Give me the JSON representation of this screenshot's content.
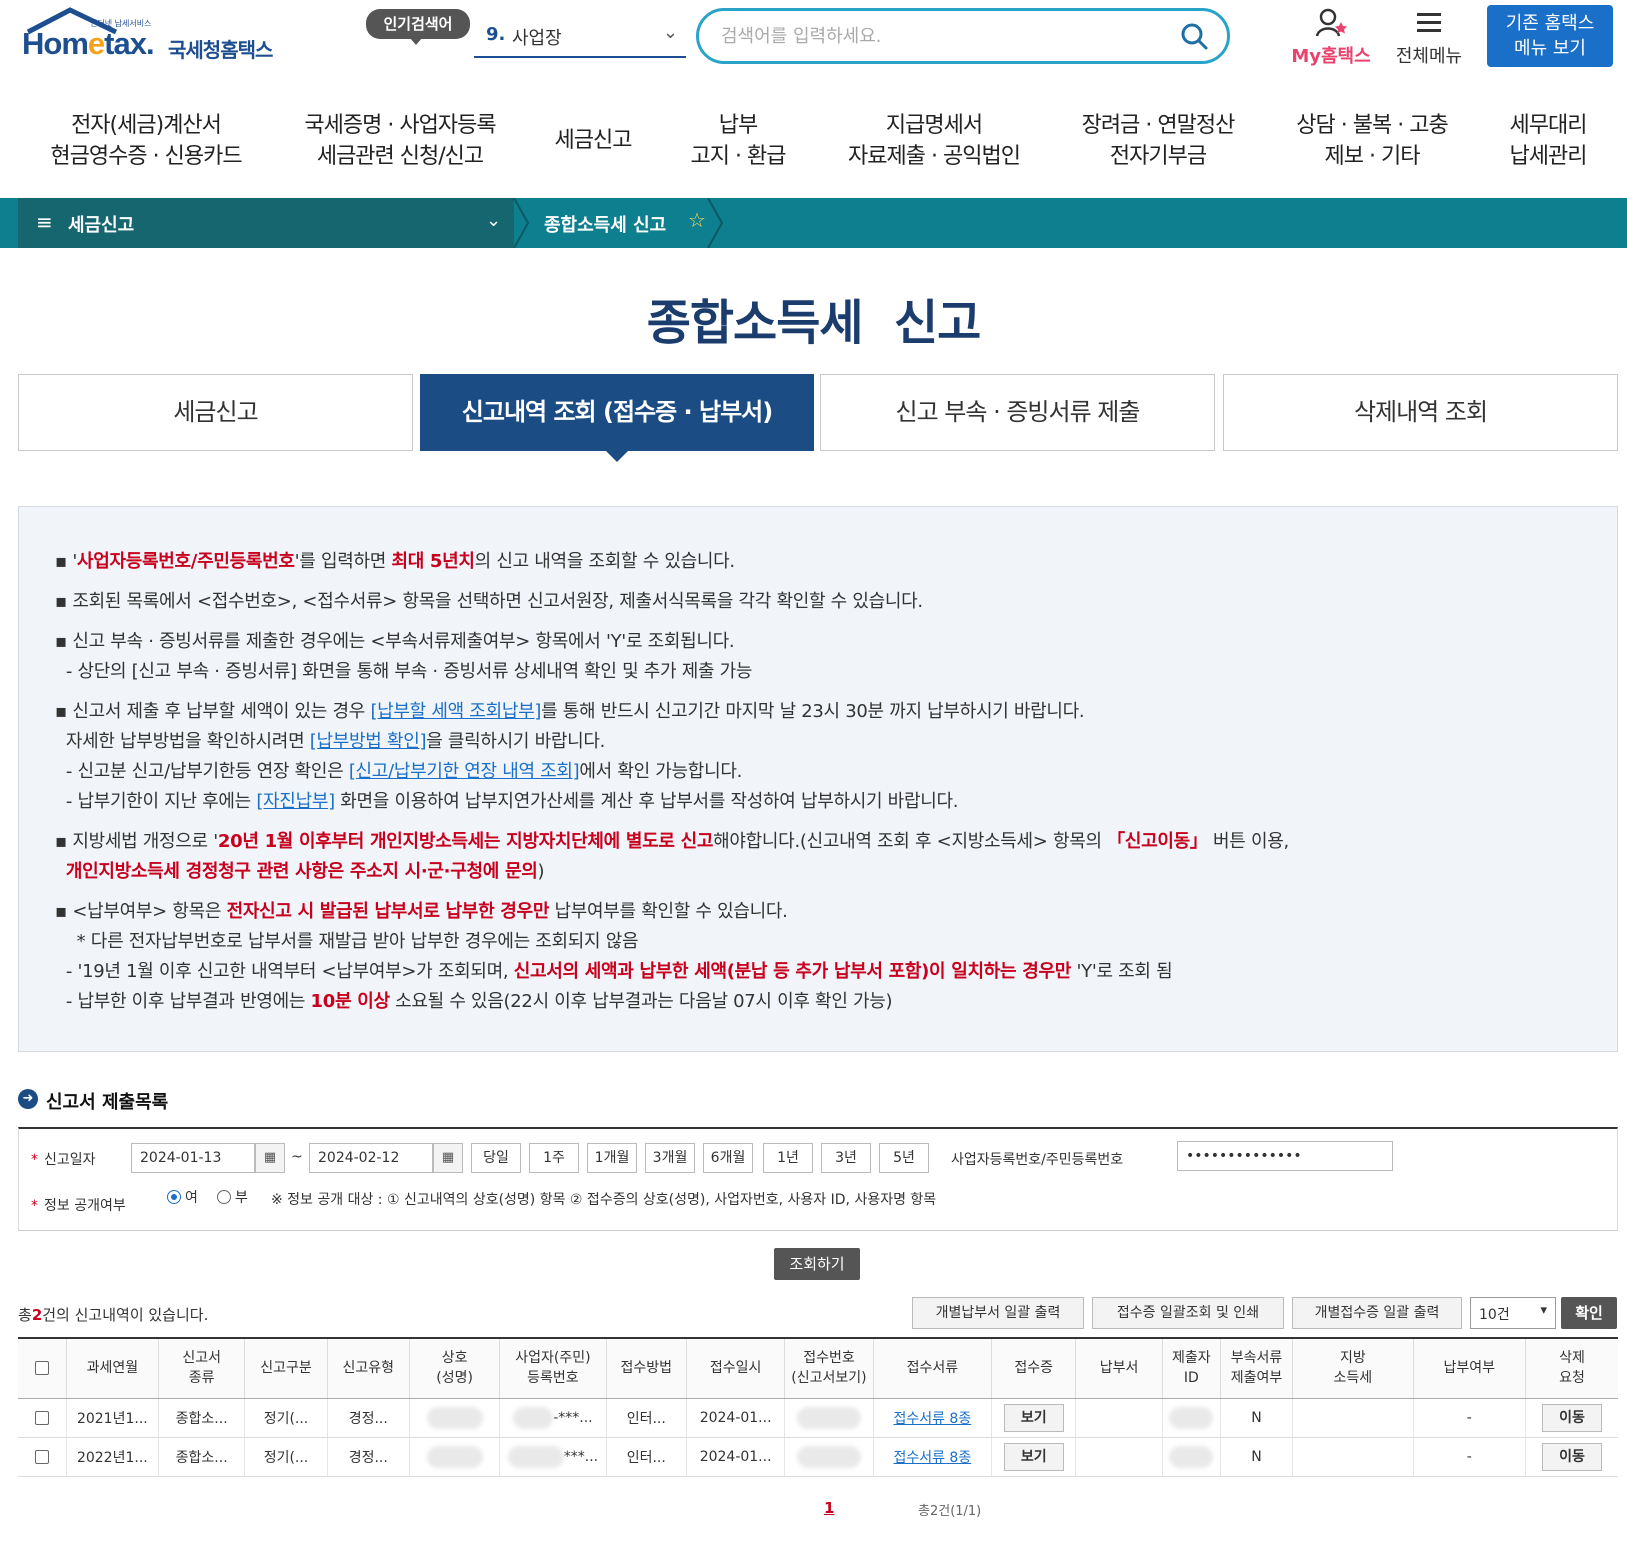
{
  "header": {
    "logo_small": "인터넷 납세서비스",
    "logo_home": "Hom",
    "logo_e": "e",
    "logo_tax": "tax.",
    "logo_kor": "국세청홈택스",
    "popular_badge": "인기검색어",
    "popular_num": "9.",
    "popular_term": "사업장",
    "search_placeholder": "검색어를 입력하세요.",
    "my_hometax": "My홈택스",
    "all_menu": "전체메뉴",
    "old_menu_line1": "기존 홈택스",
    "old_menu_line2": "메뉴 보기"
  },
  "gnb": [
    {
      "l1": "전자(세금)계산서",
      "l2": "현금영수증 · 신용카드"
    },
    {
      "l1": "국세증명 · 사업자등록",
      "l2": "세금관련 신청/신고"
    },
    {
      "l1": "세금신고",
      "l2": ""
    },
    {
      "l1": "납부",
      "l2": "고지 · 환급"
    },
    {
      "l1": "지급명세서",
      "l2": "자료제출 · 공익법인"
    },
    {
      "l1": "장려금 · 연말정산",
      "l2": "전자기부금"
    },
    {
      "l1": "상담 · 불복 · 고충",
      "l2": "제보 · 기타"
    },
    {
      "l1": "세무대리",
      "l2": "납세관리"
    }
  ],
  "breadcrumb": {
    "menu_icon": "hamburger-icon",
    "section": "세금신고",
    "current": "종합소득세 신고",
    "star": "☆"
  },
  "page_title": "종합소득세  신고",
  "tabs": [
    {
      "label": "세금신고",
      "active": false
    },
    {
      "label": "신고내역 조회 (접수증 · 납부서)",
      "active": true
    },
    {
      "label": "신고 부속 · 증빙서류 제출",
      "active": false
    },
    {
      "label": "삭제내역 조회",
      "active": false
    }
  ],
  "info": {
    "l1_a": "▪ '",
    "l1_b": "사업자등록번호/주민등록번호",
    "l1_c": "'를 입력하면 ",
    "l1_d": "최대 5년치",
    "l1_e": "의 신고 내역을 조회할 수 있습니다.",
    "l2": "▪ 조회된 목록에서 <접수번호>, <접수서류> 항목을 선택하면 신고서원장, 제출서식목록을 각각 확인할 수 있습니다.",
    "l3": "▪ 신고 부속 · 증빙서류를 제출한 경우에는 <부속서류제출여부> 항목에서 'Y'로 조회됩니다.",
    "l4": "  - 상단의 [신고 부속 · 증빙서류] 화면을 통해 부속 · 증빙서류 상세내역 확인 및 추가 제출 가능",
    "l5_a": "▪ 신고서 제출 후 납부할 세액이 있는 경우 ",
    "l5_b": "[납부할 세액 조회납부]",
    "l5_c": "를 통해 반드시 신고기간 마지막 날 23시 30분 까지 납부하시기 바랍니다.",
    "l6_a": "  자세한 납부방법을 확인하시려면 ",
    "l6_b": "[납부방법 확인]",
    "l6_c": "을 클릭하시기 바랍니다.",
    "l7_a": "  - 신고분 신고/납부기한등 연장 확인은 ",
    "l7_b": "[신고/납부기한 연장 내역 조회]",
    "l7_c": "에서 확인 가능합니다.",
    "l8_a": "  - 납부기한이 지난 후에는 ",
    "l8_b": "[자진납부]",
    "l8_c": " 화면을 이용하여 납부지연가산세를 계산 후 납부서를 작성하여 납부하시기 바랍니다.",
    "l9_a": "▪ 지방세법 개정으로 '",
    "l9_b": "20년 1월 이후부터 개인지방소득세는 지방자치단체에 별도로 신고",
    "l9_c": "해야합니다.(신고내역 조회 후 <지방소득세> 항목의 ",
    "l9_d": "「신고이동」",
    "l9_e": " 버튼 이용,",
    "l10_a": "  ",
    "l10_b": "개인지방소득세 경정청구 관련 사항은 주소지 시·군·구청에 문의",
    "l10_c": ")",
    "l11_a": "▪ <납부여부> 항목은 ",
    "l11_b": "전자신고 시 발급된 납부서로 납부한 경우만",
    "l11_c": " 납부여부를 확인할 수 있습니다.",
    "l12": "    * 다른 전자납부번호로 납부서를 재발급 받아 납부한 경우에는 조회되지 않음",
    "l13_a": "  - '19년 1월 이후 신고한 내역부터 <납부여부>가 조회되며, ",
    "l13_b": "신고서의 세액과 납부한 세액(분납 등 추가 납부서 포함)이 일치하는 경우만",
    "l13_c": " 'Y'로 조회 됨",
    "l14_a": "  - 납부한 이후 납부결과 반영에는 ",
    "l14_b": "10분 이상",
    "l14_c": " 소요될 수 있음(22시 이후 납부결과는 다음날 07시 이후 확인 가능)"
  },
  "section": {
    "title": "신고서 제출목록",
    "icon": "arrow-circle-icon"
  },
  "form": {
    "date_label": "신고일자",
    "date_from": "2024-01-13",
    "date_to": "2024-02-12",
    "tilde": "~",
    "periods": [
      "당일",
      "1주",
      "1개월",
      "3개월",
      "6개월",
      "1년",
      "3년",
      "5년"
    ],
    "biz_label": "사업자등록번호/주민등록번호",
    "biz_value": "••••••••••••••",
    "disclose_label": "정보 공개여부",
    "radio_yes": "여",
    "radio_no": "부",
    "disclose_selected": "여",
    "notice": "※ 정보 공개 대상 : ① 신고내역의 상호(성명) 항목 ② 접수증의 상호(성명), 사업자번호, 사용자 ID, 사용자명 항목",
    "query_btn": "조회하기"
  },
  "list": {
    "total_a": "총",
    "total_count": "2",
    "total_b": "건의 신고내역이 있습니다.",
    "btn_payment_print": "개별납부서 일괄 출력",
    "btn_receipt_print": "접수증 일괄조회 및 인쇄",
    "btn_each_receipt": "개별접수증 일괄 출력",
    "page_size": "10건",
    "confirm": "확인"
  },
  "table": {
    "headers": [
      {
        "l1": "",
        "l2": ""
      },
      {
        "l1": "과세연월",
        "l2": ""
      },
      {
        "l1": "신고서",
        "l2": "종류"
      },
      {
        "l1": "신고구분",
        "l2": ""
      },
      {
        "l1": "신고유형",
        "l2": ""
      },
      {
        "l1": "상호",
        "l2": "(성명)"
      },
      {
        "l1": "사업자(주민)",
        "l2": "등록번호"
      },
      {
        "l1": "접수방법",
        "l2": ""
      },
      {
        "l1": "접수일시",
        "l2": ""
      },
      {
        "l1": "접수번호",
        "l2": "(신고서보기)"
      },
      {
        "l1": "접수서류",
        "l2": ""
      },
      {
        "l1": "접수증",
        "l2": ""
      },
      {
        "l1": "납부서",
        "l2": ""
      },
      {
        "l1": "제출자",
        "l2": "ID"
      },
      {
        "l1": "부속서류",
        "l2": "제출여부"
      },
      {
        "l1": "지방",
        "l2": "소득세"
      },
      {
        "l1": "납부여부",
        "l2": ""
      },
      {
        "l1": "삭제",
        "l2": "요청"
      }
    ],
    "rows": [
      {
        "period": "2021년1...",
        "kind": "종합소...",
        "div": "정기(...",
        "type": "경정...",
        "biz_suffix": "-***...",
        "method": "인터...",
        "date": "2024-01...",
        "docs": "접수서류 8종",
        "receipt_btn": "보기",
        "attach": "N",
        "paid": "-",
        "move_btn": "이동"
      },
      {
        "period": "2022년1...",
        "kind": "종합소...",
        "div": "정기(...",
        "type": "경정...",
        "biz_suffix": "***...",
        "method": "인터...",
        "date": "2024-01...",
        "docs": "접수서류 8종",
        "receipt_btn": "보기",
        "attach": "N",
        "paid": "-",
        "move_btn": "이동"
      }
    ]
  },
  "pager": {
    "current": "1",
    "summary": "총2건(1/1)"
  },
  "colors": {
    "brand_navy": "#1b4d84",
    "teal_bar": "#0e7f8f",
    "accent_red": "#c8001e",
    "link_blue": "#1a6fc9"
  }
}
